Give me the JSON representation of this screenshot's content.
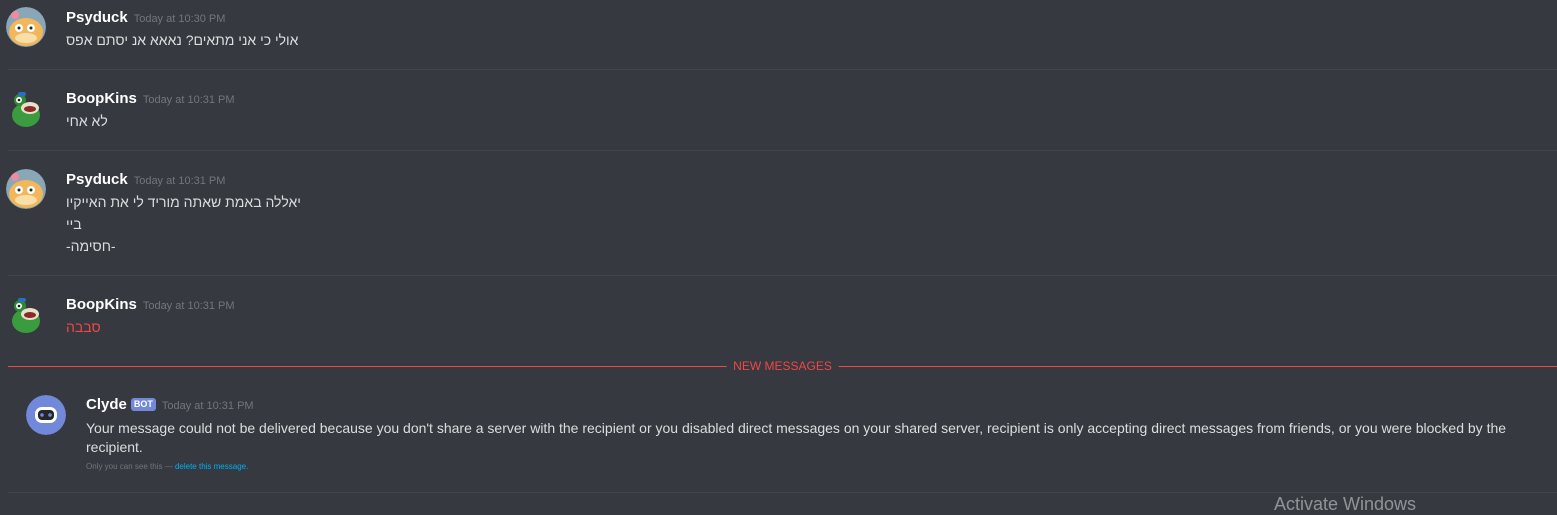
{
  "messages": [
    {
      "author": "Psyduck",
      "timestamp": "Today at 10:30 PM",
      "avatar": "psyduck-avatar-icon",
      "lines": [
        "אולי כי אני מתאים? נאאא אנ יסתם אפס"
      ]
    },
    {
      "author": "BoopKins",
      "timestamp": "Today at 10:31 PM",
      "avatar": "frog-avatar-icon",
      "lines": [
        "לא אחי"
      ]
    },
    {
      "author": "Psyduck",
      "timestamp": "Today at 10:31 PM",
      "avatar": "psyduck-avatar-icon",
      "lines": [
        "יאללה באמת שאתה מוריד לי את האייקיו",
        "ביי",
        "-חסימה-"
      ]
    },
    {
      "author": "BoopKins",
      "timestamp": "Today at 10:31 PM",
      "avatar": "frog-avatar-icon",
      "lines": [
        "סבבה"
      ],
      "line_color": "#f04747"
    }
  ],
  "new_messages_label": "NEW MESSAGES",
  "clyde": {
    "author": "Clyde",
    "bot_tag": "BOT",
    "timestamp": "Today at 10:31 PM",
    "avatar": "clyde-bot-avatar-icon",
    "text": "Your message could not be delivered because you don't share a server with the recipient or you disabled direct messages on your shared server, recipient is only accepting direct messages from friends, or you were blocked by the recipient.",
    "ephemeral_note": "Only you can see this —",
    "delete_link": "delete this message."
  },
  "watermark": "Activate Windows",
  "colors": {
    "background": "#36393f",
    "accent_red": "#f04747",
    "bot_tag": "#7289da",
    "link": "#00b0f4"
  }
}
